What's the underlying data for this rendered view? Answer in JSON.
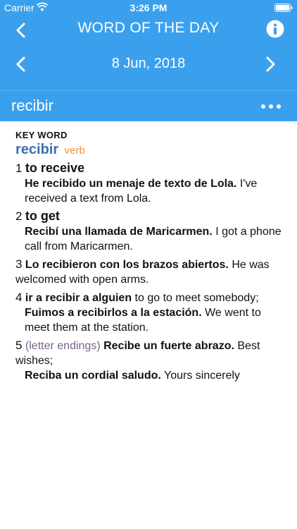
{
  "status": {
    "carrier": "Carrier",
    "time": "3:26 PM"
  },
  "nav": {
    "title": "WORD OF THE DAY"
  },
  "date": {
    "label": "8 Jun, 2018"
  },
  "word": {
    "title": "recibir"
  },
  "entry": {
    "keyword_label": "KEY WORD",
    "headword": "recibir",
    "pos": "verb",
    "senses": [
      {
        "num": "1",
        "gloss": "to receive",
        "example_es": "He recibido un menaje de texto de Lola.",
        "example_en": "I've received a text from Lola."
      },
      {
        "num": "2",
        "gloss": "to get",
        "example_es": "Recibí una llamada de Maricarmen.",
        "example_en": "I got a phone call from Maricarmen."
      },
      {
        "num": "3",
        "example_es": "Lo recibieron con los brazos abiertos.",
        "example_en": "He was welcomed with open arms."
      },
      {
        "num": "4",
        "phrase": "ir a recibir a alguien",
        "phrase_en": "to go to meet somebody;",
        "example_es": "Fuimos a recibirlos a la estación.",
        "example_en": "We went to meet them at the station."
      },
      {
        "num": "5",
        "note": "(letter endings)",
        "example_es": "Recibe un fuerte abrazo.",
        "example_en": "Best wishes;",
        "example2_es": "Reciba un cordial saludo.",
        "example2_en": "Yours sincerely"
      }
    ]
  }
}
